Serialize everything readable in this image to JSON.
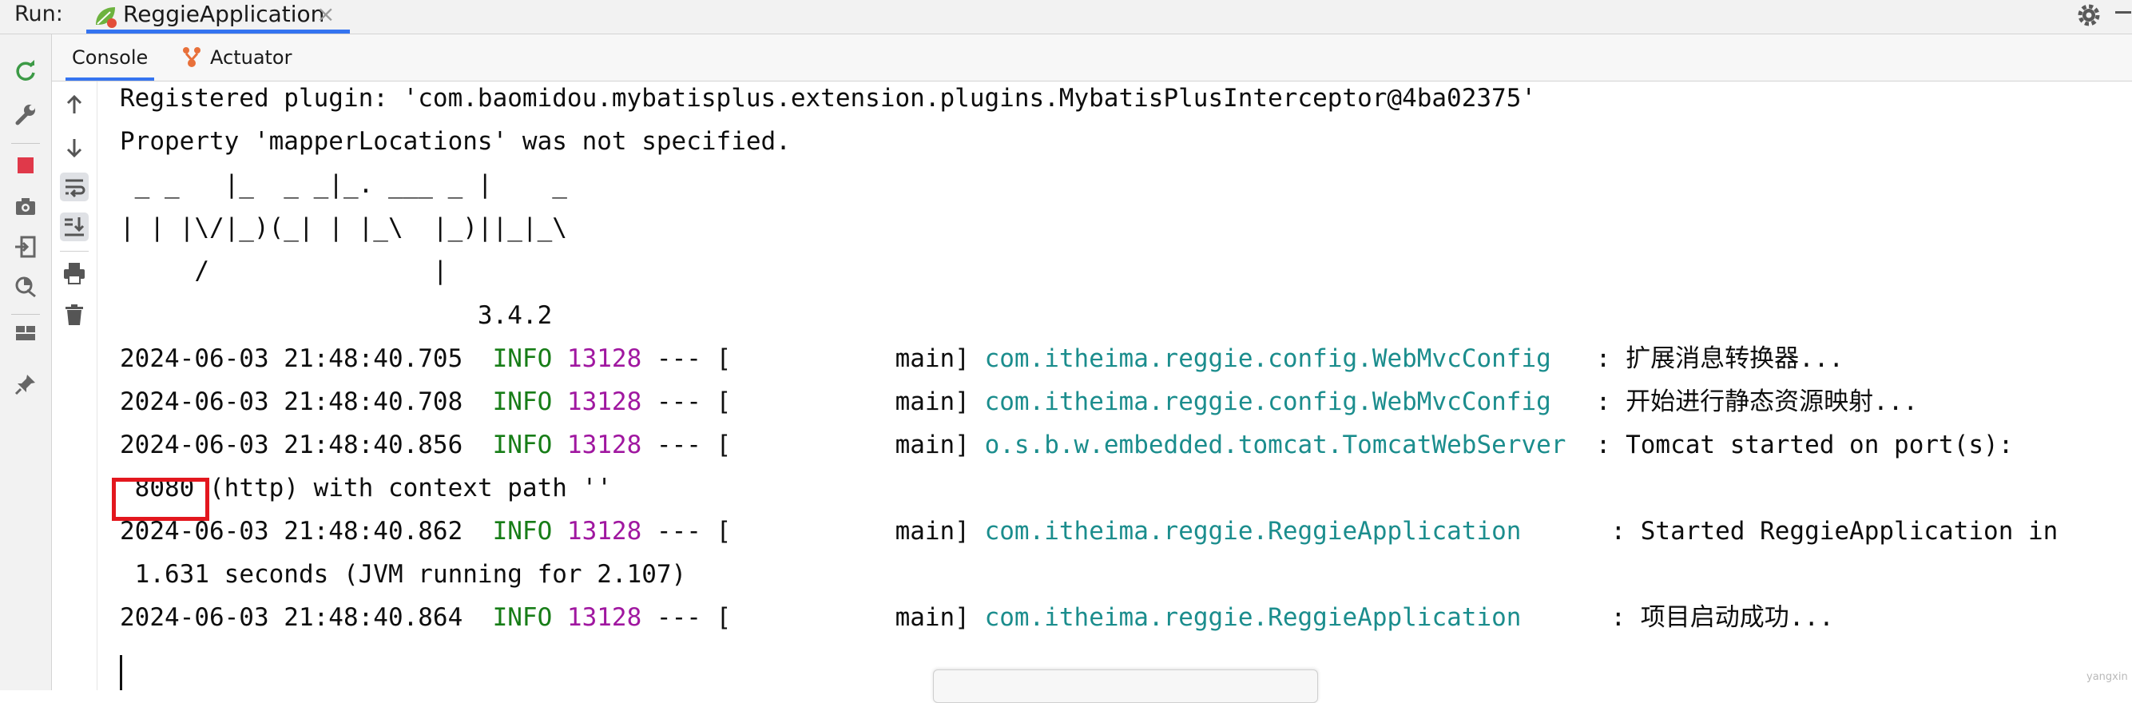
{
  "runbar": {
    "run_label": "Run:",
    "tab_title": "ReggieApplication",
    "tab_close": "×",
    "icons": [
      "spring-leaf-icon",
      "gear-icon",
      "minimize-icon"
    ],
    "accent": "#3574f0"
  },
  "tabs": {
    "console": "Console",
    "actuator": "Actuator"
  },
  "gutter_icons": [
    "rerun-icon",
    "wrench-icon",
    "stop-icon",
    "camera-icon",
    "exit-icon",
    "coverage-icon",
    "layout-icon",
    "pin-icon"
  ],
  "console_actions": [
    "scroll-up-icon",
    "scroll-down-icon",
    "soft-wrap-icon",
    "scroll-to-end-icon",
    "print-icon",
    "trash-icon"
  ],
  "console": {
    "line1": "Registered plugin: 'com.baomidou.mybatisplus.extension.plugins.MybatisPlusInterceptor@4ba02375'",
    "line2": "Property 'mapperLocations' was not specified.",
    "banner1": " _ _   |_  _ _|_. ___ _ |    _",
    "banner2": "| | |\\/|_)(_| | |_\\  |_)||_|_\\",
    "banner3": "     /               |",
    "banner4": "                        3.4.2",
    "logs": [
      {
        "time": "2024-06-03 21:48:40.705",
        "level": "INFO",
        "pid": "13128",
        "sep": "--- [",
        "thread": "main]",
        "logger": "com.itheima.reggie.config.WebMvcConfig",
        "msg": ": 扩展消息转换器..."
      },
      {
        "time": "2024-06-03 21:48:40.708",
        "level": "INFO",
        "pid": "13128",
        "sep": "--- [",
        "thread": "main]",
        "logger": "com.itheima.reggie.config.WebMvcConfig",
        "msg": ": 开始进行静态资源映射..."
      },
      {
        "time": "2024-06-03 21:48:40.856",
        "level": "INFO",
        "pid": "13128",
        "sep": "--- [",
        "thread": "main]",
        "logger": "o.s.b.w.embedded.tomcat.TomcatWebServer",
        "msg": ": Tomcat started on port(s):",
        "cont_highlight": "8080",
        "cont": "(http) with context path ''"
      },
      {
        "time": "2024-06-03 21:48:40.862",
        "level": "INFO",
        "pid": "13128",
        "sep": "--- [",
        "thread": "main]",
        "logger": "com.itheima.reggie.ReggieApplication",
        "msg": ": Started ReggieApplication in",
        "cont": "1.631 seconds (JVM running for 2.107)"
      },
      {
        "time": "2024-06-03 21:48:40.864",
        "level": "INFO",
        "pid": "13128",
        "sep": "--- [",
        "thread": "main]",
        "logger": "com.itheima.reggie.ReggieApplication",
        "msg": ": 项目启动成功..."
      }
    ],
    "colors": {
      "level": "#177d17",
      "pid": "#a017a0",
      "logger": "#1b8d8d",
      "highlight_box": "#e3171e"
    }
  },
  "watermark": "yangxin"
}
